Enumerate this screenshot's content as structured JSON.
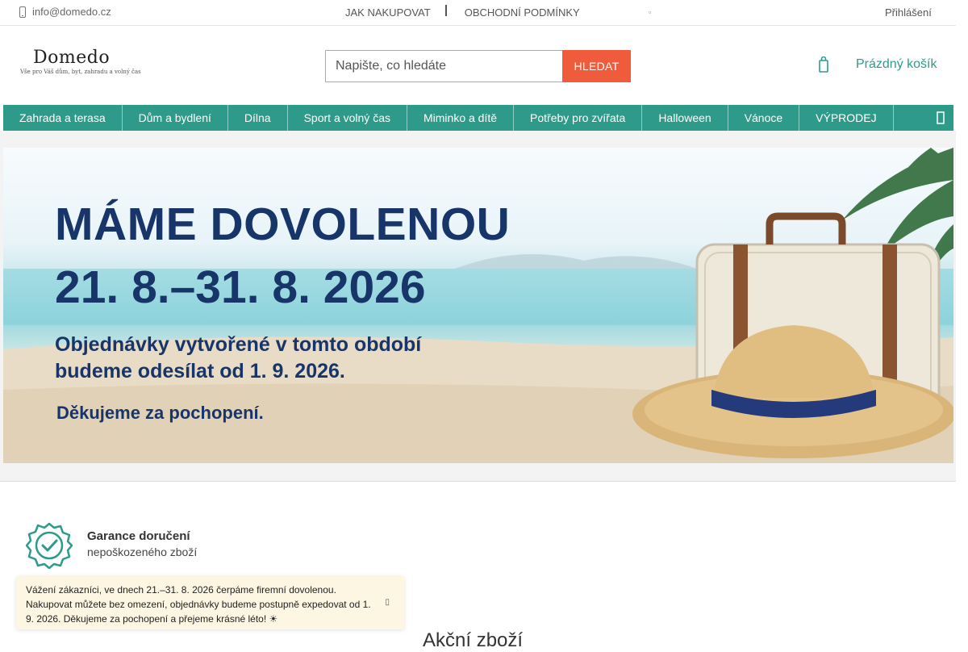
{
  "topbar": {
    "email": "info@domedo.cz",
    "link_how_to_buy": "JAK NAKUPOVAT",
    "link_terms": "OBCHODNÍ PODMÍNKY",
    "login": "Přihlášení"
  },
  "header": {
    "logo_brand": "Domedo",
    "logo_tagline": "Vše pro Váš dům, byt, zahradu a volný čas",
    "search_placeholder": "Napište, co hledáte",
    "search_button": "HLEDAT",
    "cart_label": "Prázdný košík"
  },
  "nav": {
    "items": [
      {
        "label": "Zahrada a terasa"
      },
      {
        "label": "Dům a bydlení"
      },
      {
        "label": "Dílna"
      },
      {
        "label": "Sport a volný čas"
      },
      {
        "label": "Miminko a dítě"
      },
      {
        "label": "Potřeby pro zvířata"
      },
      {
        "label": "Halloween"
      },
      {
        "label": "Vánoce"
      },
      {
        "label": "VÝPRODEJ"
      }
    ]
  },
  "banner": {
    "headline_1": "MÁME DOVOLENOU",
    "headline_2": "21. 8.–31. 8. 2026",
    "text_1": "Objednávky vytvořené v tomto období",
    "text_2": "budeme odesílat od 1. 9. 2026.",
    "thanks": "Děkujeme za pochopení."
  },
  "guarantee": {
    "title": "Garance doručení",
    "subtitle": "nepoškozeného zboží"
  },
  "notice": {
    "text": "Vážení zákazníci, ve dnech 21.–31. 8. 2026 čerpáme firemní dovolenou. Nakupovat můžete bez omezení, objednávky budeme postupně expedovat od 1. 9. 2026. Děkujeme za pochopení a přejeme krásné léto! ☀"
  },
  "section": {
    "title": "Akční zboží"
  },
  "colors": {
    "accent": "#2e9a8a",
    "search_button": "#f05b3c",
    "banner_text": "#18356a",
    "notice_bg": "#fdf6e3"
  },
  "icons": {
    "email": "phone-icon",
    "cart": "cart-icon",
    "nav_more": "chevron-right-icon",
    "guarantee": "badge-check-icon",
    "notice_close": "close-icon"
  }
}
